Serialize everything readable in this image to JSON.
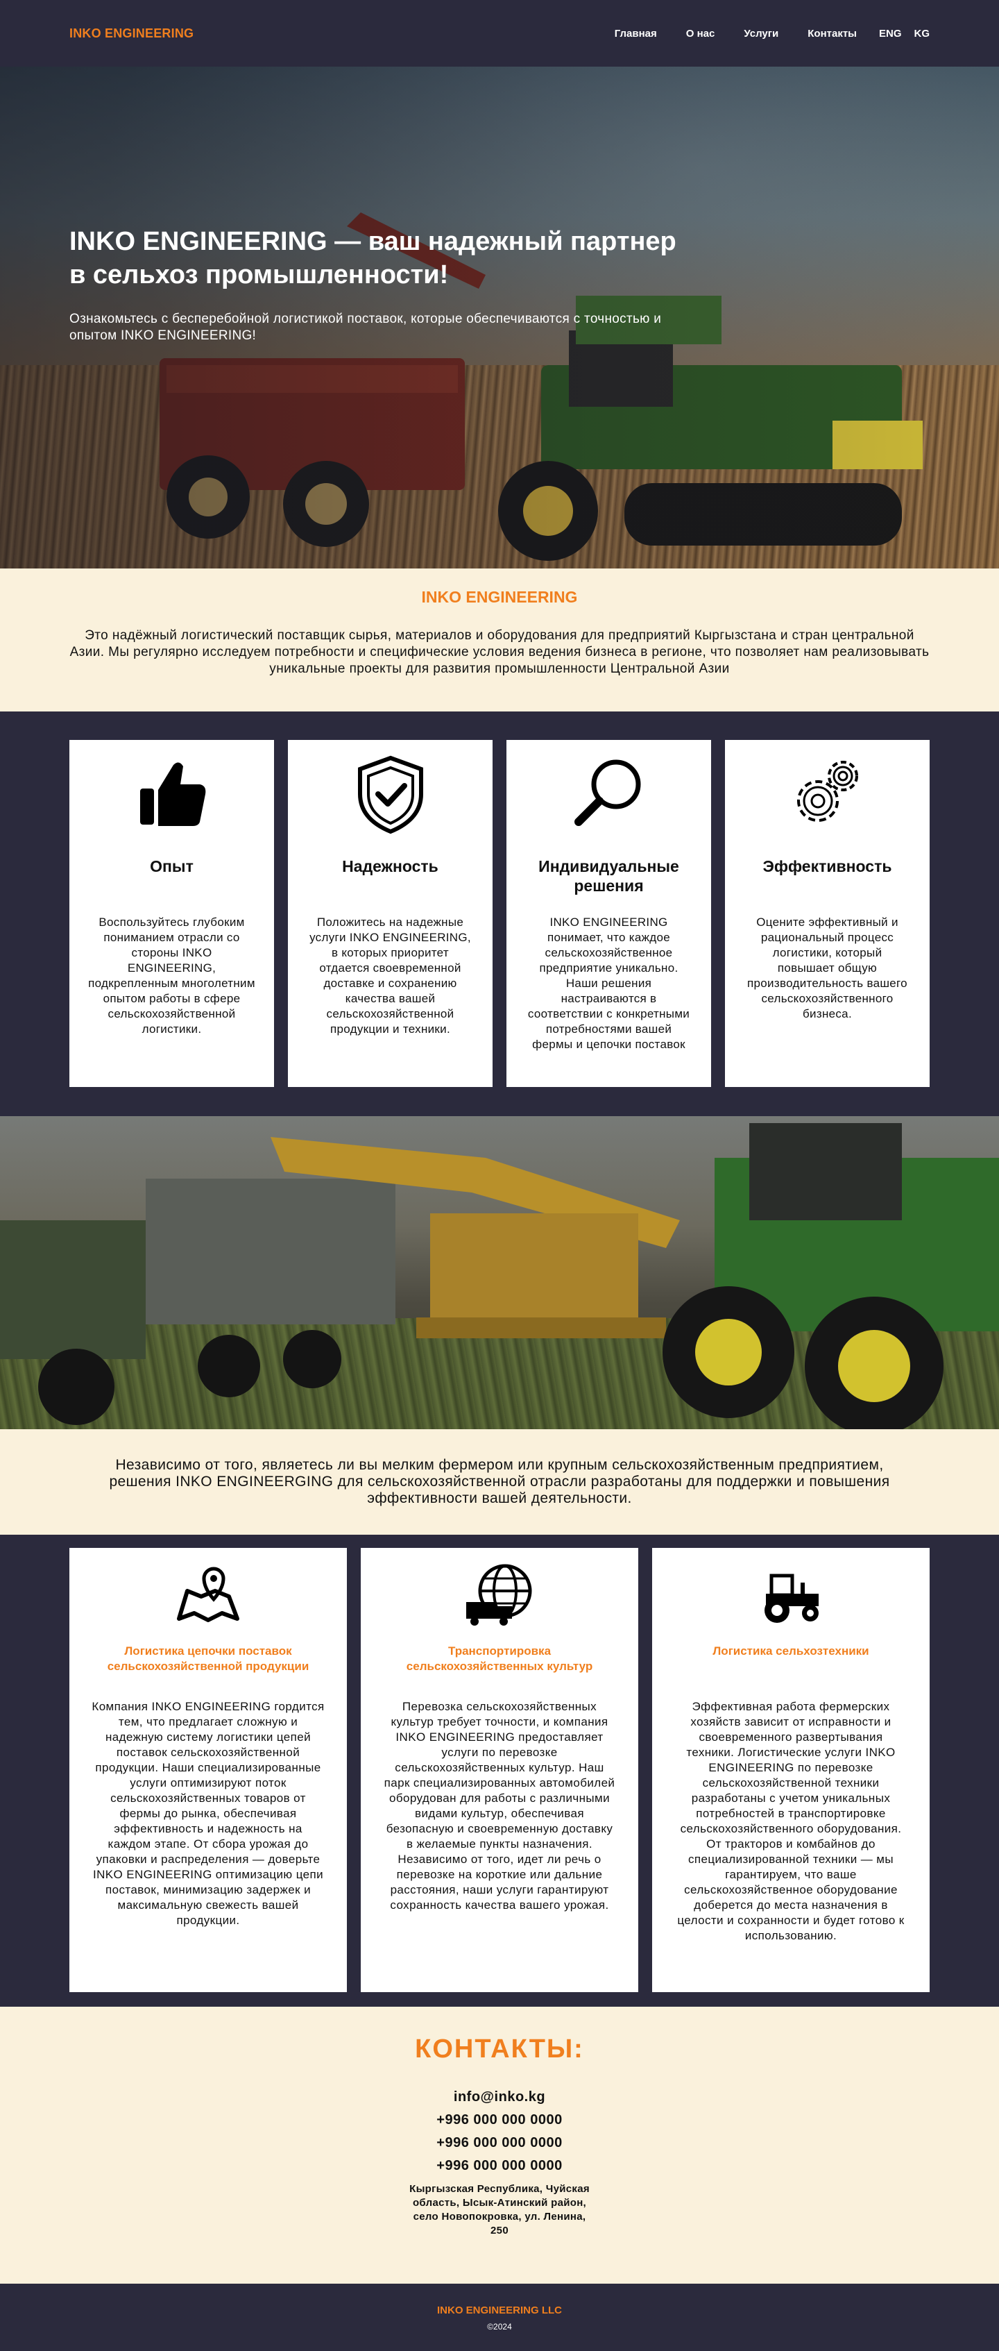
{
  "header": {
    "brand": "INKO ENGINEERING",
    "nav": [
      "Главная",
      "О нас",
      "Услуги",
      "Контакты"
    ],
    "langs": [
      "ENG",
      "KG"
    ]
  },
  "hero": {
    "title": "INKO ENGINEERING — ваш надежный партнер в сельхоз промышленности!",
    "subtitle": "Ознакомьтесь с бесперебойной логистикой поставок, которые обеспечиваются с точностью и опытом INKO ENGINEERING!"
  },
  "intro": {
    "title": "INKO ENGINEERING",
    "text": "Это надёжный логистический поставщик сырья, материалов и оборудования для предприятий Кыргызстана и стран центральной Азии. Мы регулярно исследуем потребности и специфические условия ведения бизнеса в регионе, что позволяет нам реализовывать уникальные проекты для развития промышленности Центральной Азии"
  },
  "features": [
    {
      "icon": "thumbs-up-icon",
      "title": "Опыт",
      "text": "Воспользуйтесь глубоким пониманием отрасли со стороны INKO ENGINEERING, подкрепленным многолетним опытом работы в сфере сельскохозяйственной логистики."
    },
    {
      "icon": "shield-check-icon",
      "title": "Надежность",
      "text": "Положитесь на надежные услуги INKO ENGINEERING, в которых приоритет отдается своевременной доставке и сохранению качества вашей сельскохозяйственной продукции и техники."
    },
    {
      "icon": "magnifier-icon",
      "title": "Индивидуальные решения",
      "text": "INKO ENGINEERING понимает, что каждое сельскохозяйственное предприятие уникально. Наши решения настраиваются в соответствии с конкретными потребностями вашей фермы и цепочки поставок"
    },
    {
      "icon": "gears-icon",
      "title": "Эффективность",
      "text": "Оцените эффективный и рациональный процесс логистики, который повышает общую производительность вашего сельскохозяйственного бизнеса."
    }
  ],
  "solution": {
    "text": "Независимо от того, являетесь ли вы мелким фермером или крупным сельскохозяйственным предприятием, решения INKO ENGINEERGING для сельскохозяйственной отрасли разработаны для поддержки и повышения эффективности вашей деятельности."
  },
  "services": [
    {
      "icon": "map-pin-icon",
      "title": "Логистика цепочки поставок сельскохозяйственной продукции",
      "text": "Компания INKO ENGINEERING гордится тем, что предлагает сложную и надежную систему логистики цепей поставок сельскохозяйственной продукции. Наши специализированные услуги оптимизируют поток сельскохозяйственных товаров от фермы до рынка, обеспечивая эффективность и надежность на каждом этапе. От сбора урожая до упаковки и распределения — доверьте INKO ENGINEERING оптимизацию цепи поставок, минимизацию задержек и максимальную свежесть вашей продукции."
    },
    {
      "icon": "globe-truck-icon",
      "title": "Транспортировка сельскохозяйственных культур",
      "text": "Перевозка сельскохозяйственных культур требует точности, и компания INKO ENGINEERING предоставляет услуги по перевозке сельскохозяйственных культур. Наш парк специализированных автомобилей оборудован для работы с различными видами культур, обеспечивая безопасную и своевременную доставку в желаемые пункты назначения. Независимо от того, идет ли речь о перевозке на короткие или дальние расстояния, наши услуги гарантируют сохранность качества вашего урожая."
    },
    {
      "icon": "tractor-icon",
      "title": "Логистика сельхозтехники",
      "text": "Эффективная работа фермерских хозяйств зависит от исправности и своевременного развертывания техники. Логистические услуги INKO ENGINEERING по перевозке сельскохозяйственной техники разработаны с учетом уникальных потребностей в транспортировке сельскохозяйственного оборудования. От тракторов и комбайнов до специализированной техники — мы гарантируем, что ваше сельскохозяйственное оборудование доберется до места назначения в целости и сохранности и будет готово к использованию."
    }
  ],
  "contacts": {
    "title": "КОНТАКТЫ:",
    "email": "info@inko.kg",
    "phones": [
      "+996 000 000 0000",
      "+996 000 000 0000",
      "+996 000 000 0000"
    ],
    "address": "Кыргызская Республика, Чуйская область, Ысык-Атинский район, село Новопокровка, ул. Ленина, 250"
  },
  "footer": {
    "brand": "INKO ENGINEERING LLC",
    "year": "©2024"
  },
  "colors": {
    "accent": "#f07f1e",
    "dark": "#2b2a3d",
    "cream": "#faf1dc"
  }
}
